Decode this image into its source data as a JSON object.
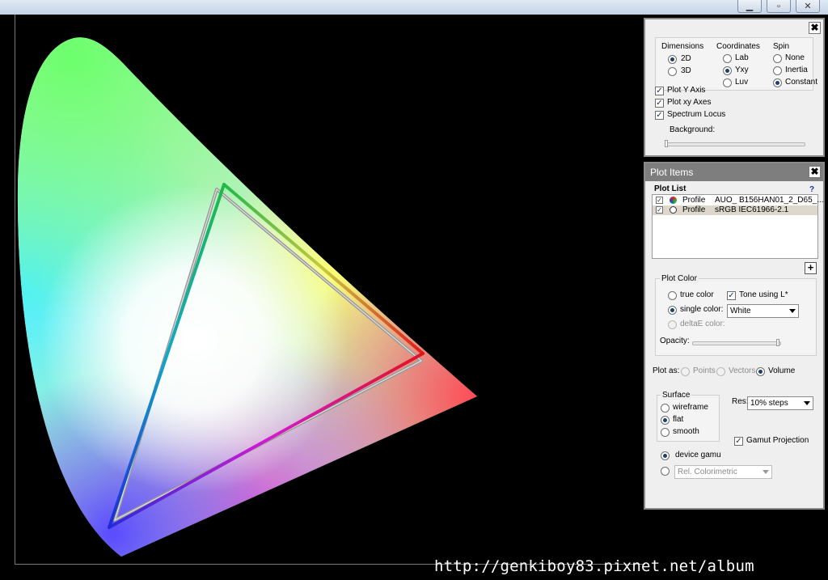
{
  "window": {
    "controls": {
      "minimize": "▁",
      "restore": "▫",
      "close": "✕"
    }
  },
  "plot": {
    "watermark": "http://genkiboy83.pixnet.net/album"
  },
  "display_panel": {
    "close": "✖",
    "dimensions": {
      "title": "Dimensions",
      "options": [
        "2D",
        "3D"
      ],
      "selected": "2D"
    },
    "coordinates": {
      "title": "Coordinates",
      "options": [
        "Lab",
        "Yxy",
        "Luv"
      ],
      "selected": "Yxy"
    },
    "spin": {
      "title": "Spin",
      "options": [
        "None",
        "Inertia",
        "Constant"
      ],
      "selected": "Constant"
    },
    "checks": [
      {
        "label": "Plot Y Axis",
        "checked": true
      },
      {
        "label": "Plot xy Axes",
        "checked": true
      },
      {
        "label": "Spectrum Locus",
        "checked": true
      }
    ],
    "background_label": "Background:"
  },
  "plot_items_panel": {
    "title": "Plot Items",
    "close": "✖",
    "plot_list_label": "Plot List",
    "help": "?",
    "items": [
      {
        "checked": true,
        "type": "Profile",
        "name": "AUO_ B156HAN01_2_D65_..."
      },
      {
        "checked": true,
        "type": "Profile",
        "name": "sRGB IEC61966-2.1"
      }
    ],
    "add_button": "+",
    "plot_color": {
      "title": "Plot Color",
      "true_color": "true color",
      "single_color": "single color:",
      "deltaE_color": "deltaE color:",
      "selected": "single color:",
      "tone_label": "Tone using L*",
      "tone_checked": true,
      "color_value": "White",
      "opacity_label": "Opacity:"
    },
    "plot_as": {
      "label": "Plot as:",
      "options": [
        "Points",
        "Vectors",
        "Volume"
      ],
      "selected": "Volume"
    },
    "surface": {
      "title": "Surface",
      "options": [
        "wireframe",
        "flat",
        "smooth"
      ],
      "selected": "flat"
    },
    "res": {
      "label": "Res:",
      "value": "10% steps"
    },
    "gamut_projection": {
      "label": "Gamut Projection",
      "checked": true
    },
    "device_gamut": "device gamu",
    "rendering_intent": "Rel. Colorimetric"
  }
}
